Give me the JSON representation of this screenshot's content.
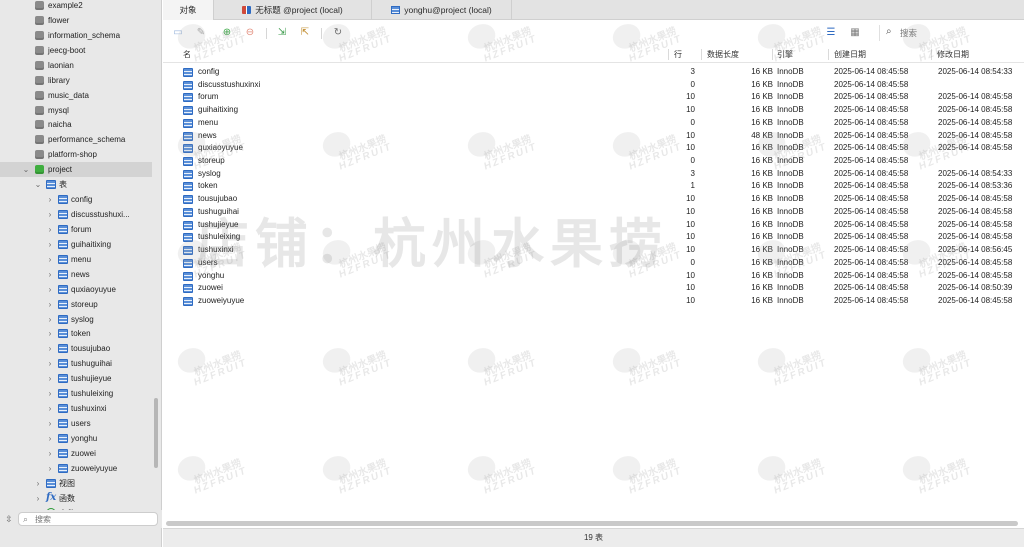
{
  "sidebar": {
    "items": [
      {
        "label": "example2",
        "kind": "db",
        "level": 0
      },
      {
        "label": "flower",
        "kind": "db",
        "level": 0
      },
      {
        "label": "information_schema",
        "kind": "db",
        "level": 0
      },
      {
        "label": "jeecg-boot",
        "kind": "db",
        "level": 0
      },
      {
        "label": "laonian",
        "kind": "db",
        "level": 0
      },
      {
        "label": "library",
        "kind": "db",
        "level": 0
      },
      {
        "label": "music_data",
        "kind": "db",
        "level": 0
      },
      {
        "label": "mysql",
        "kind": "db",
        "level": 0
      },
      {
        "label": "naicha",
        "kind": "db",
        "level": 0
      },
      {
        "label": "performance_schema",
        "kind": "db",
        "level": 0
      },
      {
        "label": "platform-shop",
        "kind": "db",
        "level": 0
      },
      {
        "label": "project",
        "kind": "db-open",
        "level": 0,
        "expanded": true
      },
      {
        "label": "表",
        "kind": "group",
        "level": 1,
        "expanded": true
      },
      {
        "label": "config",
        "kind": "table",
        "level": 2
      },
      {
        "label": "discusstushuxi...",
        "kind": "table",
        "level": 2
      },
      {
        "label": "forum",
        "kind": "table",
        "level": 2
      },
      {
        "label": "guihaitixing",
        "kind": "table",
        "level": 2
      },
      {
        "label": "menu",
        "kind": "table",
        "level": 2
      },
      {
        "label": "news",
        "kind": "table",
        "level": 2
      },
      {
        "label": "quxiaoyuyue",
        "kind": "table",
        "level": 2
      },
      {
        "label": "storeup",
        "kind": "table",
        "level": 2
      },
      {
        "label": "syslog",
        "kind": "table",
        "level": 2
      },
      {
        "label": "token",
        "kind": "table",
        "level": 2
      },
      {
        "label": "tousujubao",
        "kind": "table",
        "level": 2
      },
      {
        "label": "tushuguihai",
        "kind": "table",
        "level": 2
      },
      {
        "label": "tushujieyue",
        "kind": "table",
        "level": 2
      },
      {
        "label": "tushuleixing",
        "kind": "table",
        "level": 2
      },
      {
        "label": "tushuxinxi",
        "kind": "table",
        "level": 2
      },
      {
        "label": "users",
        "kind": "table",
        "level": 2
      },
      {
        "label": "yonghu",
        "kind": "table",
        "level": 2
      },
      {
        "label": "zuowei",
        "kind": "table",
        "level": 2
      },
      {
        "label": "zuoweiyuyue",
        "kind": "table",
        "level": 2
      },
      {
        "label": "视图",
        "kind": "view-group",
        "level": 1
      },
      {
        "label": "函数",
        "kind": "function-group",
        "level": 1
      },
      {
        "label": "事件",
        "kind": "event-group",
        "level": 1
      }
    ],
    "search_placeholder": "搜索"
  },
  "tabs": [
    {
      "label": "对象",
      "icon": "none",
      "active": true
    },
    {
      "label": "无标题 @project (local)",
      "icon": "view-icon",
      "active": false
    },
    {
      "label": "yonghu@project (local)",
      "icon": "table-icon",
      "active": false
    }
  ],
  "toolbar": {
    "icons": [
      "open-table-icon",
      "design-table-icon",
      "new-table-icon",
      "delete-table-icon",
      "import-icon",
      "export-icon",
      "refresh-icon",
      "list-view-icon",
      "grid-view-icon"
    ],
    "search_placeholder": "搜索"
  },
  "table": {
    "columns": [
      "名",
      "行",
      "数据长度",
      "引擎",
      "创建日期",
      "修改日期"
    ],
    "rows": [
      {
        "name": "config",
        "rows": "3",
        "size": "16 KB",
        "engine": "InnoDB",
        "created": "2025-06-14 08:45:58",
        "modified": "2025-06-14 08:54:33"
      },
      {
        "name": "discusstushuxinxi",
        "rows": "0",
        "size": "16 KB",
        "engine": "InnoDB",
        "created": "2025-06-14 08:45:58",
        "modified": ""
      },
      {
        "name": "forum",
        "rows": "10",
        "size": "16 KB",
        "engine": "InnoDB",
        "created": "2025-06-14 08:45:58",
        "modified": "2025-06-14 08:45:58"
      },
      {
        "name": "guihaitixing",
        "rows": "10",
        "size": "16 KB",
        "engine": "InnoDB",
        "created": "2025-06-14 08:45:58",
        "modified": "2025-06-14 08:45:58"
      },
      {
        "name": "menu",
        "rows": "0",
        "size": "16 KB",
        "engine": "InnoDB",
        "created": "2025-06-14 08:45:58",
        "modified": "2025-06-14 08:45:58"
      },
      {
        "name": "news",
        "rows": "10",
        "size": "48 KB",
        "engine": "InnoDB",
        "created": "2025-06-14 08:45:58",
        "modified": "2025-06-14 08:45:58"
      },
      {
        "name": "quxiaoyuyue",
        "rows": "10",
        "size": "16 KB",
        "engine": "InnoDB",
        "created": "2025-06-14 08:45:58",
        "modified": "2025-06-14 08:45:58"
      },
      {
        "name": "storeup",
        "rows": "0",
        "size": "16 KB",
        "engine": "InnoDB",
        "created": "2025-06-14 08:45:58",
        "modified": ""
      },
      {
        "name": "syslog",
        "rows": "3",
        "size": "16 KB",
        "engine": "InnoDB",
        "created": "2025-06-14 08:45:58",
        "modified": "2025-06-14 08:54:33"
      },
      {
        "name": "token",
        "rows": "1",
        "size": "16 KB",
        "engine": "InnoDB",
        "created": "2025-06-14 08:45:58",
        "modified": "2025-06-14 08:53:36"
      },
      {
        "name": "tousujubao",
        "rows": "10",
        "size": "16 KB",
        "engine": "InnoDB",
        "created": "2025-06-14 08:45:58",
        "modified": "2025-06-14 08:45:58"
      },
      {
        "name": "tushuguihai",
        "rows": "10",
        "size": "16 KB",
        "engine": "InnoDB",
        "created": "2025-06-14 08:45:58",
        "modified": "2025-06-14 08:45:58"
      },
      {
        "name": "tushujieyue",
        "rows": "10",
        "size": "16 KB",
        "engine": "InnoDB",
        "created": "2025-06-14 08:45:58",
        "modified": "2025-06-14 08:45:58"
      },
      {
        "name": "tushuleixing",
        "rows": "10",
        "size": "16 KB",
        "engine": "InnoDB",
        "created": "2025-06-14 08:45:58",
        "modified": "2025-06-14 08:45:58"
      },
      {
        "name": "tushuxinxi",
        "rows": "10",
        "size": "16 KB",
        "engine": "InnoDB",
        "created": "2025-06-14 08:45:58",
        "modified": "2025-06-14 08:56:45"
      },
      {
        "name": "users",
        "rows": "0",
        "size": "16 KB",
        "engine": "InnoDB",
        "created": "2025-06-14 08:45:58",
        "modified": "2025-06-14 08:45:58"
      },
      {
        "name": "yonghu",
        "rows": "10",
        "size": "16 KB",
        "engine": "InnoDB",
        "created": "2025-06-14 08:45:58",
        "modified": "2025-06-14 08:45:58"
      },
      {
        "name": "zuowei",
        "rows": "10",
        "size": "16 KB",
        "engine": "InnoDB",
        "created": "2025-06-14 08:45:58",
        "modified": "2025-06-14 08:50:39"
      },
      {
        "name": "zuoweiyuyue",
        "rows": "10",
        "size": "16 KB",
        "engine": "InnoDB",
        "created": "2025-06-14 08:45:58",
        "modified": "2025-06-14 08:45:58"
      }
    ]
  },
  "status": {
    "text": "19 表"
  },
  "watermark": {
    "main_text": "店铺：杭州水果捞",
    "tile_cn": "杭州水果捞",
    "tile_en": "HZFRUIT"
  },
  "colors": {
    "accent": "#2f6bc2",
    "active_db": "#3fae3f",
    "sidebar_bg": "#e8e8e8"
  }
}
